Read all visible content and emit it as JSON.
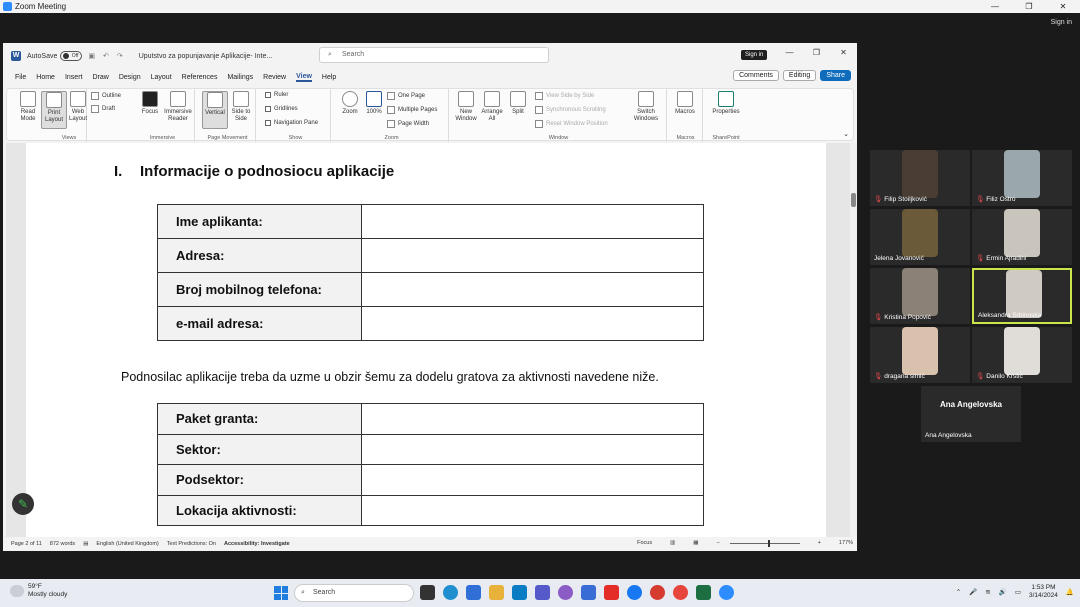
{
  "zoom": {
    "title": "Zoom Meeting",
    "signin": "Sign in"
  },
  "word": {
    "autosave_label": "AutoSave",
    "autosave_state": "Off",
    "document_title": "Uputstvo za popunjavanje Aplikacije- Inte... ",
    "search_placeholder": "Search",
    "signin": "Sign in",
    "menu": [
      "File",
      "Home",
      "Insert",
      "Draw",
      "Design",
      "Layout",
      "References",
      "Mailings",
      "Review",
      "View",
      "Help"
    ],
    "active_menu": "View",
    "comments_btn": "Comments",
    "editing_btn": "Editing",
    "share_btn": "Share"
  },
  "ribbon": {
    "views": {
      "read_mode": "Read Mode",
      "print_layout": "Print Layout",
      "web_layout": "Web Layout",
      "outline": "Outline",
      "draft": "Draft",
      "group": "Views"
    },
    "immersive": {
      "focus": "Focus",
      "reader": "Immersive Reader",
      "group": "Immersive"
    },
    "page_movement": {
      "vertical": "Vertical",
      "side": "Side to Side",
      "group": "Page Movement"
    },
    "show": {
      "ruler": "Ruler",
      "gridlines": "Gridlines",
      "nav_pane": "Navigation Pane",
      "group": "Show"
    },
    "zoom": {
      "zoom": "Zoom",
      "hundred": "100%",
      "one_page": "One Page",
      "multiple_pages": "Multiple Pages",
      "page_width": "Page Width",
      "group": "Zoom"
    },
    "window": {
      "new_window": "New Window",
      "arrange_all": "Arrange All",
      "split": "Split",
      "view_side": "View Side by Side",
      "sync_scroll": "Synchronous Scrolling",
      "reset_pos": "Reset Window Position",
      "switch": "Switch Windows",
      "group": "Window"
    },
    "macros": {
      "macros": "Macros",
      "group": "Macros"
    },
    "sharepoint": {
      "properties": "Properties",
      "group": "SharePoint"
    }
  },
  "document": {
    "heading_num": "I.",
    "heading_text": "Informacije o podnosiocu aplikacije",
    "table1": [
      "Ime aplikanta:",
      "Adresa:",
      "Broj mobilnog telefona:",
      "e-mail adresa:"
    ],
    "paragraph": "Podnosilac aplikacije treba da uzme u obzir šemu za dodelu gratova za aktivnosti navedene niže.",
    "table2": [
      "Paket granta:",
      "Sektor:",
      "Podsektor:",
      "Lokacija aktivnosti:"
    ]
  },
  "status": {
    "page": "Page 2 of 11",
    "words": "872 words",
    "language": "English (United Kingdom)",
    "predictions": "Text Predictions: On",
    "accessibility": "Accessibility: Investigate",
    "focus": "Focus",
    "zoom": "177%"
  },
  "participants": [
    {
      "name": "Filip Stoiljković",
      "muted": true,
      "bg": "#4a3d33"
    },
    {
      "name": "Filiz Ostro",
      "muted": true,
      "bg": "#9aa7ad"
    },
    {
      "name": "Jelena Jovanović",
      "muted": false,
      "bg": "#6b5a3a"
    },
    {
      "name": "Ermin Ajradini",
      "muted": true,
      "bg": "#c9c4bc"
    },
    {
      "name": "Kristina Popović",
      "muted": true,
      "bg": "#8b8176"
    },
    {
      "name": "Aleksandra Srbinoska",
      "muted": false,
      "bg": "#cfcac3"
    },
    {
      "name": "dragana simić",
      "muted": true,
      "bg": "#d8c2ae"
    },
    {
      "name": "Danilo Krstić",
      "muted": true,
      "bg": "#e0ddd8"
    },
    {
      "name": "Ana Angelovska",
      "muted": false,
      "bg": "#2a2a2a"
    }
  ],
  "taskbar": {
    "temp": "59°F",
    "weather": "Mostly cloudy",
    "search": "Search",
    "time": "1:53 PM",
    "date": "3/14/2024"
  }
}
